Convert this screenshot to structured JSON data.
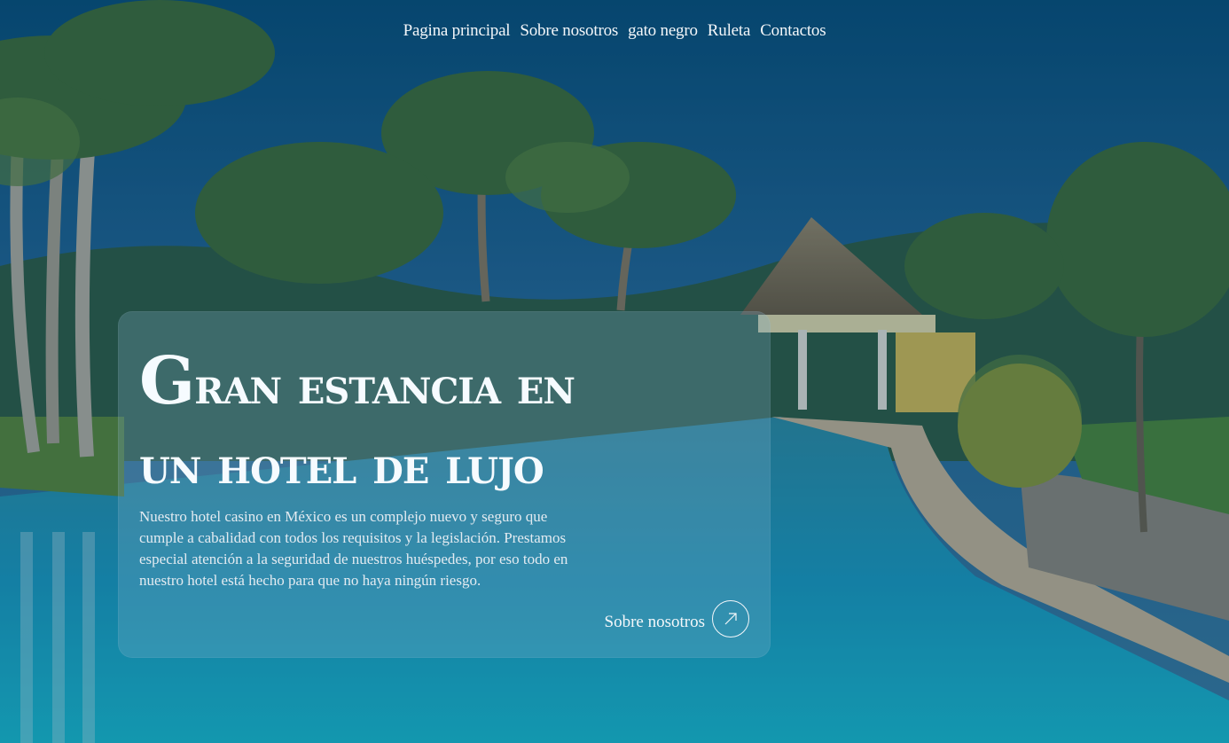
{
  "nav": {
    "items": [
      {
        "label": "Pagina principal"
      },
      {
        "label": "Sobre nosotros"
      },
      {
        "label": "gato negro"
      },
      {
        "label": "Ruleta"
      },
      {
        "label": "Contactos"
      }
    ]
  },
  "hero": {
    "title_line1_cap": "G",
    "title_line1_rest": "ran estancia en",
    "title_line2": "un hotel de lujo",
    "description": "Nuestro hotel casino en México es un complejo nuevo y seguro que cumple a cabalidad con todos los requisitos y la legislación. Prestamos especial atención a la seguridad de nuestros huéspedes, por eso todo en nuestro hotel está hecho para que no haya ningún riesgo.",
    "cta_label": "Sobre nosotros",
    "cta_icon": "arrow-up-right-icon"
  },
  "colors": {
    "sky": "#0c4a72",
    "pool": "#139cc0",
    "text": "#f4f7fa",
    "card": "#82afc8"
  }
}
